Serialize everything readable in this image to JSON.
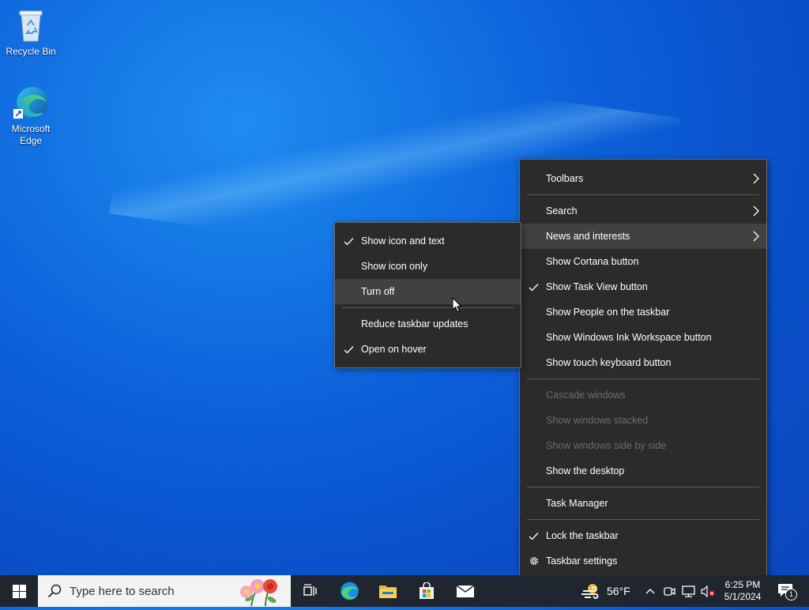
{
  "desktop": {
    "icons": [
      {
        "label": "Recycle Bin"
      },
      {
        "label": "Microsoft Edge"
      }
    ]
  },
  "taskbar_menu": {
    "items": [
      {
        "label": "Toolbars",
        "submenu": true
      },
      {
        "label": "Search",
        "submenu": true
      },
      {
        "label": "News and interests",
        "submenu": true,
        "highlighted": true
      },
      {
        "label": "Show Cortana button"
      },
      {
        "label": "Show Task View button",
        "checked": true
      },
      {
        "label": "Show People on the taskbar"
      },
      {
        "label": "Show Windows Ink Workspace button"
      },
      {
        "label": "Show touch keyboard button"
      },
      {
        "label": "Cascade windows",
        "disabled": true
      },
      {
        "label": "Show windows stacked",
        "disabled": true
      },
      {
        "label": "Show windows side by side",
        "disabled": true
      },
      {
        "label": "Show the desktop"
      },
      {
        "label": "Task Manager"
      },
      {
        "label": "Lock the taskbar",
        "checked": true
      },
      {
        "label": "Taskbar settings",
        "icon": "gear-icon"
      }
    ]
  },
  "news_submenu": {
    "items": [
      {
        "label": "Show icon and text",
        "checked": true
      },
      {
        "label": "Show icon only"
      },
      {
        "label": "Turn off",
        "highlighted": true
      },
      {
        "label": "Reduce taskbar updates"
      },
      {
        "label": "Open on hover",
        "checked": true
      }
    ]
  },
  "taskbar": {
    "search_placeholder": "Type here to search",
    "weather_temp": "56°F",
    "time": "6:25 PM",
    "date": "5/1/2024",
    "notification_count": "1"
  },
  "colors": {
    "menu_bg": "#2b2b2b",
    "menu_highlight": "#414141",
    "taskbar_bg": "#1f2630",
    "desktop_blue": "#0b5fd8"
  }
}
